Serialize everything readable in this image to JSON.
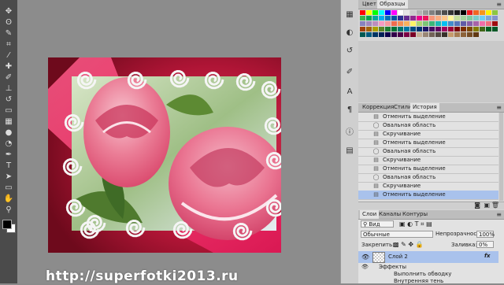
{
  "toolbar": {
    "tools": [
      {
        "name": "move-tool-icon",
        "glyph": "✥"
      },
      {
        "name": "lasso-tool-icon",
        "glyph": "ʘ"
      },
      {
        "name": "quick-select-tool-icon",
        "glyph": "✎"
      },
      {
        "name": "crop-tool-icon",
        "glyph": "⌗"
      },
      {
        "name": "eyedropper-tool-icon",
        "glyph": "⁄"
      },
      {
        "name": "healing-brush-tool-icon",
        "glyph": "✚"
      },
      {
        "name": "brush-tool-icon",
        "glyph": "✐"
      },
      {
        "name": "clone-stamp-tool-icon",
        "glyph": "⊥"
      },
      {
        "name": "history-brush-tool-icon",
        "glyph": "↺"
      },
      {
        "name": "eraser-tool-icon",
        "glyph": "▭"
      },
      {
        "name": "gradient-tool-icon",
        "glyph": "▦"
      },
      {
        "name": "blur-tool-icon",
        "glyph": "●"
      },
      {
        "name": "dodge-tool-icon",
        "glyph": "◔"
      },
      {
        "name": "pen-tool-icon",
        "glyph": "✒"
      },
      {
        "name": "type-tool-icon",
        "glyph": "T"
      },
      {
        "name": "path-select-tool-icon",
        "glyph": "➤"
      },
      {
        "name": "shape-tool-icon",
        "glyph": "▭"
      },
      {
        "name": "hand-tool-icon",
        "glyph": "✋"
      },
      {
        "name": "zoom-tool-icon",
        "glyph": "⚲"
      }
    ],
    "foreground_color": "#000000",
    "background_color": "#ffffff"
  },
  "watermark": "http://superfotki2013.ru",
  "swatches_panel": {
    "tabs": [
      {
        "label": "Цвет",
        "active": false
      },
      {
        "label": "Образцы",
        "active": true
      }
    ],
    "colors": [
      "#ff0000",
      "#ffff00",
      "#00ff00",
      "#00ffff",
      "#0000ff",
      "#ff00ff",
      "#ffffff",
      "#e6e6e6",
      "#cccccc",
      "#b3b3b3",
      "#999999",
      "#808080",
      "#666666",
      "#4d4d4d",
      "#333333",
      "#1a1a1a",
      "#000000",
      "#ed1c24",
      "#f26522",
      "#f7941d",
      "#fff200",
      "#8dc63f",
      "#39b54a",
      "#00a651",
      "#00a99d",
      "#00aeef",
      "#0072bc",
      "#0054a6",
      "#2e3192",
      "#662d91",
      "#92278f",
      "#ec008c",
      "#ed145b",
      "#f7977a",
      "#f9ad81",
      "#fdc68a",
      "#fff79a",
      "#c4df9b",
      "#a3d39c",
      "#82ca9d",
      "#7bcdc8",
      "#6ecff6",
      "#7ea7d8",
      "#8493ca",
      "#8882be",
      "#a187be",
      "#bc8dbf",
      "#f49ac2",
      "#f6989d",
      "#f26c4f",
      "#f68e55",
      "#fbaf5c",
      "#fff467",
      "#acd372",
      "#7cc576",
      "#3bb878",
      "#1abbb4",
      "#00bff3",
      "#438ccb",
      "#5574b9",
      "#605ca8",
      "#855fa8",
      "#a763a8",
      "#f06ea9",
      "#f26d7d",
      "#9e0b0f",
      "#a0410d",
      "#a36209",
      "#aba000",
      "#598527",
      "#1a7b30",
      "#007236",
      "#00746b",
      "#0076a3",
      "#004b80",
      "#003471",
      "#1b1464",
      "#440e62",
      "#630460",
      "#9e005d",
      "#9e0039",
      "#790000",
      "#7b2e00",
      "#7d4900",
      "#827b00",
      "#406618",
      "#005e20",
      "#005826",
      "#005952",
      "#005b7f",
      "#003663",
      "#002157",
      "#0d004c",
      "#32004b",
      "#4b0049",
      "#7b0046",
      "#7a0026",
      "#c7b299",
      "#998675",
      "#736357",
      "#534741",
      "#37302a",
      "#c69c6d",
      "#a67c52",
      "#8c6239",
      "#754c24",
      "#603913"
    ]
  },
  "dock_icons": [
    "swatches-dock-icon",
    "adjustments-dock-icon",
    "history-dock-icon",
    "brush-dock-icon",
    "character-dock-icon",
    "paragraph-dock-icon",
    "info-dock-icon",
    "layers-dock-icon"
  ],
  "history_panel": {
    "tabs": [
      {
        "label": "Коррекция",
        "active": false
      },
      {
        "label": "Стили",
        "active": false
      },
      {
        "label": "История",
        "active": true
      }
    ],
    "items": [
      {
        "label": "Отменить выделение",
        "icon": "doc"
      },
      {
        "label": "Овальная область",
        "icon": "oval"
      },
      {
        "label": "Скручивание",
        "icon": "doc"
      },
      {
        "label": "Отменить выделение",
        "icon": "doc"
      },
      {
        "label": "Овальная область",
        "icon": "oval"
      },
      {
        "label": "Скручивание",
        "icon": "doc"
      },
      {
        "label": "Отменить выделение",
        "icon": "doc"
      },
      {
        "label": "Овальная область",
        "icon": "oval"
      },
      {
        "label": "Скручивание",
        "icon": "doc"
      },
      {
        "label": "Отменить выделение",
        "icon": "doc",
        "selected": true
      }
    ]
  },
  "layers_panel": {
    "tabs": [
      {
        "label": "Слои",
        "active": true
      },
      {
        "label": "Каналы",
        "active": false
      },
      {
        "label": "Контуры",
        "active": false
      }
    ],
    "filter_label": "Вид",
    "blend_mode": "Обычные",
    "opacity_label": "Непрозрачность:",
    "opacity_value": "100%",
    "lock_label": "Закрепить:",
    "fill_label": "Заливка:",
    "fill_value": "0%",
    "layer_name": "Слой 2",
    "fx_label": "fx",
    "effects_label": "Эффекты",
    "effects": [
      "Выполнить обводку",
      "Внутренняя тень"
    ]
  }
}
